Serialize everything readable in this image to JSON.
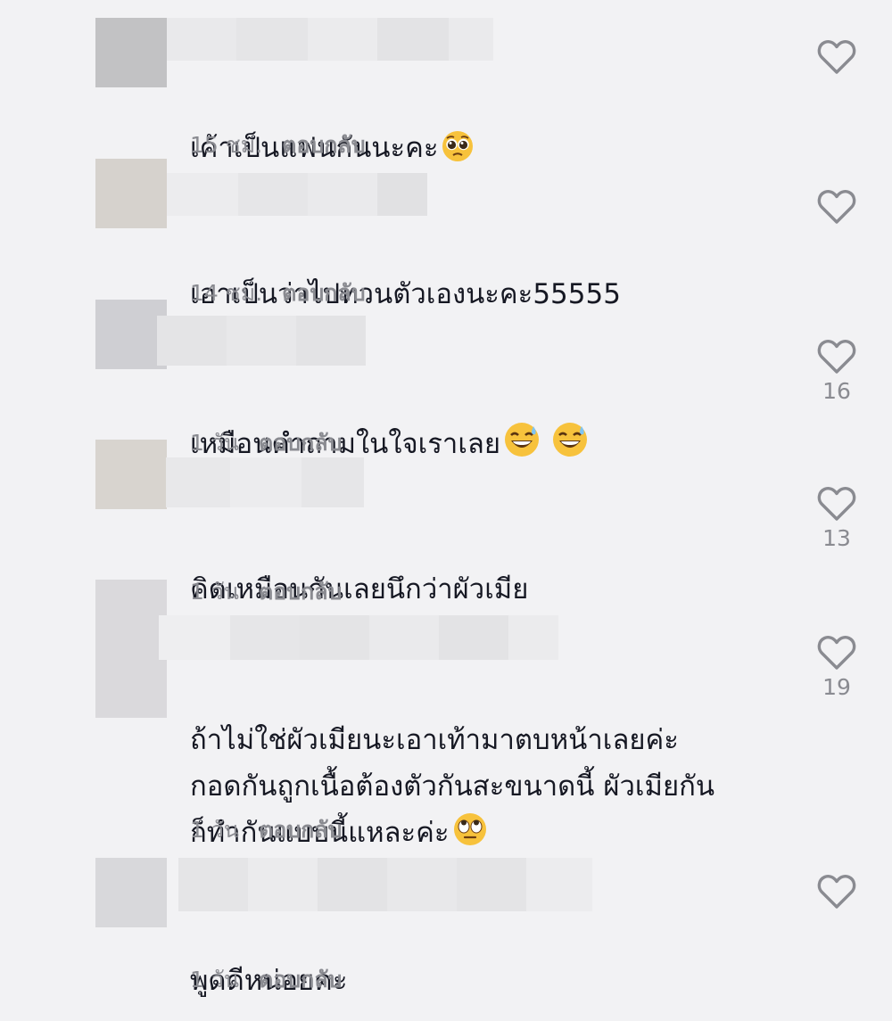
{
  "comments": [
    {
      "text": "เค้าเป็นแฟนกันนะคะ",
      "emoji": [
        "pleading-face"
      ],
      "time": "15 ชม.",
      "reply": "ตอบกลับ",
      "likes": ""
    },
    {
      "text": "เอาเป็นว่าไปทวนตัวเองนะคะ55555",
      "emoji": [],
      "time": "14 ชม.",
      "reply": "ตอบกลับ",
      "likes": ""
    },
    {
      "text": "เหมือนคำถามในใจเราเลย",
      "emoji": [
        "sweat-smile",
        "sweat-smile"
      ],
      "time": "1 วัน",
      "reply": "ตอบกลับ",
      "likes": "16"
    },
    {
      "text": "คิดเหมือนกันเลยนึกว่าผัวเมีย",
      "emoji": [],
      "time": "1 วัน",
      "reply": "ตอบกลับ",
      "likes": "13"
    },
    {
      "text": "ถ้าไม่ใช่ผัวเมียนะเอาเท้ามาตบหน้าเลยค่ะ\nกอดกันถูกเนื้อต้องตัวกันสะขนาดนี้ ผัวเมียกัน\nก็ทำกันแบบนี้แหละค่ะ",
      "emoji": [
        "rolling-eyes"
      ],
      "time": "1 วัน",
      "reply": "ตอบกลับ",
      "likes": "19"
    },
    {
      "text": "พูดดีหน่อยคะ",
      "emoji": [],
      "time": "1 วัน",
      "reply": "ตอบกลับ",
      "likes": ""
    }
  ],
  "colors": {
    "background": "#f2f2f4",
    "text": "#161823",
    "meta": "#8a8b91",
    "icon": "#8a8b91"
  }
}
